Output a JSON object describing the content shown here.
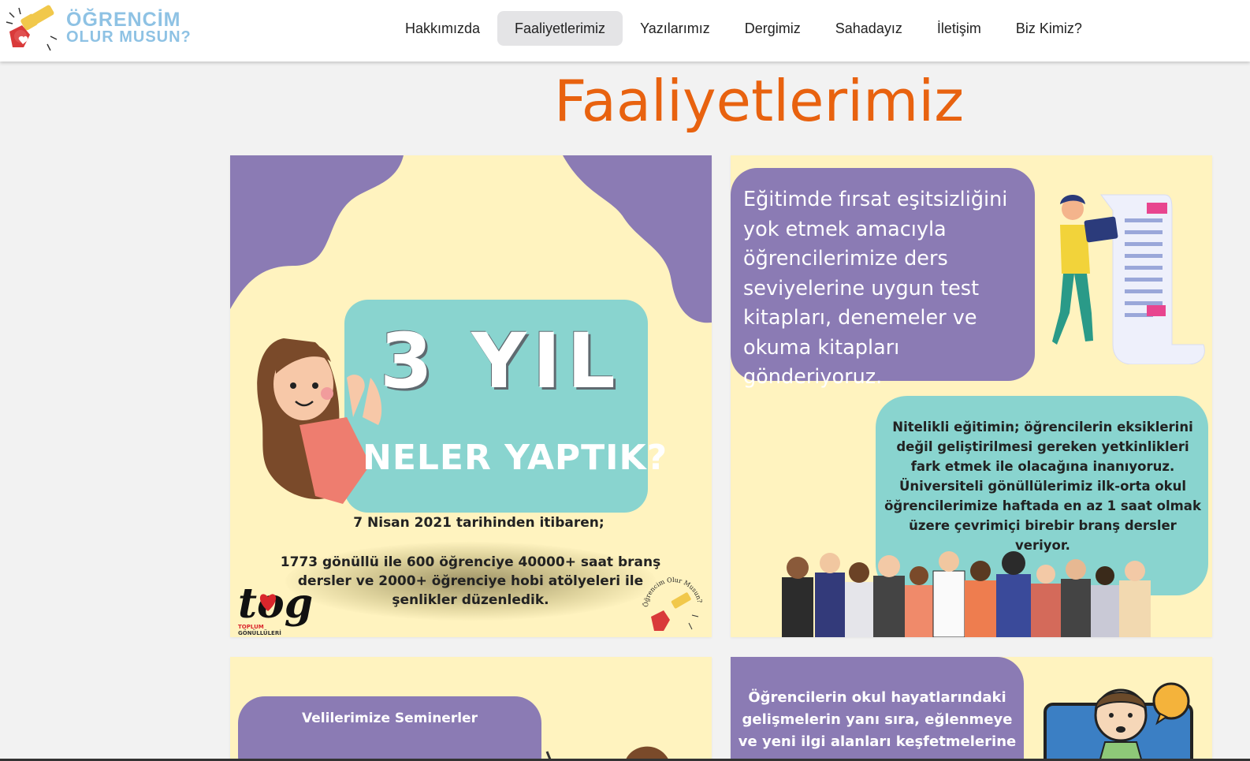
{
  "brand": {
    "line1": "ÖĞRENCİM",
    "line2": "OLUR MUSUN?",
    "color": "#8ec2e4"
  },
  "nav": {
    "items": [
      {
        "label": "Hakkımızda",
        "active": false
      },
      {
        "label": "Faaliyetlerimiz",
        "active": true
      },
      {
        "label": "Yazılarımız",
        "active": false
      },
      {
        "label": "Dergimiz",
        "active": false
      },
      {
        "label": "Sahadayız",
        "active": false
      },
      {
        "label": "İletişim",
        "active": false
      },
      {
        "label": "Biz Kimiz?",
        "active": false
      }
    ]
  },
  "page": {
    "title": "Faaliyetlerimiz",
    "title_color": "#e8620f"
  },
  "cards": {
    "card1": {
      "headline": "3 YIL",
      "subheadline": "NELER YAPTIK?",
      "date_line": "7 Nisan 2021 tarihinden  itibaren;",
      "body": "1773 gönüllü ile 600 öğrenciye 40000+ saat branş dersler ve 2000+ öğrenciye hobi atölyeleri ile şenlikler düzenledik.",
      "tog_logo": "tog",
      "tog_caption_1": "TOPLUM",
      "tog_caption_2": "GÖNÜLLÜLERİ",
      "stamp_text": "Öğrencim Olur Musun?"
    },
    "card2": {
      "text1": "Eğitimde fırsat eşitsizliğini yok etmek amacıyla öğrencilerimize ders seviyelerine uygun test kitapları, denemeler ve okuma kitapları gönderiyoruz.",
      "text2": "Nitelikli eğitimin; öğrencilerin eksiklerini değil geliştirilmesi gereken yetkinlikleri fark etmek ile olacağına inanıyoruz. Üniversiteli gönüllülerimiz ilk-orta okul öğrencilerimize haftada en az 1 saat olmak üzere çevrimiçi birebir branş dersler veriyor."
    },
    "card3": {
      "title": "Velilerimize Seminerler"
    },
    "card4": {
      "text": "Öğrencilerin okul hayatlarındaki gelişmelerin yanı sıra, eğlenmeye ve yeni ilgi alanları keşfetmelerine"
    }
  },
  "colors": {
    "card_bg": "#fff3bf",
    "purple": "#8b7bb4",
    "teal": "#89d4cf"
  }
}
